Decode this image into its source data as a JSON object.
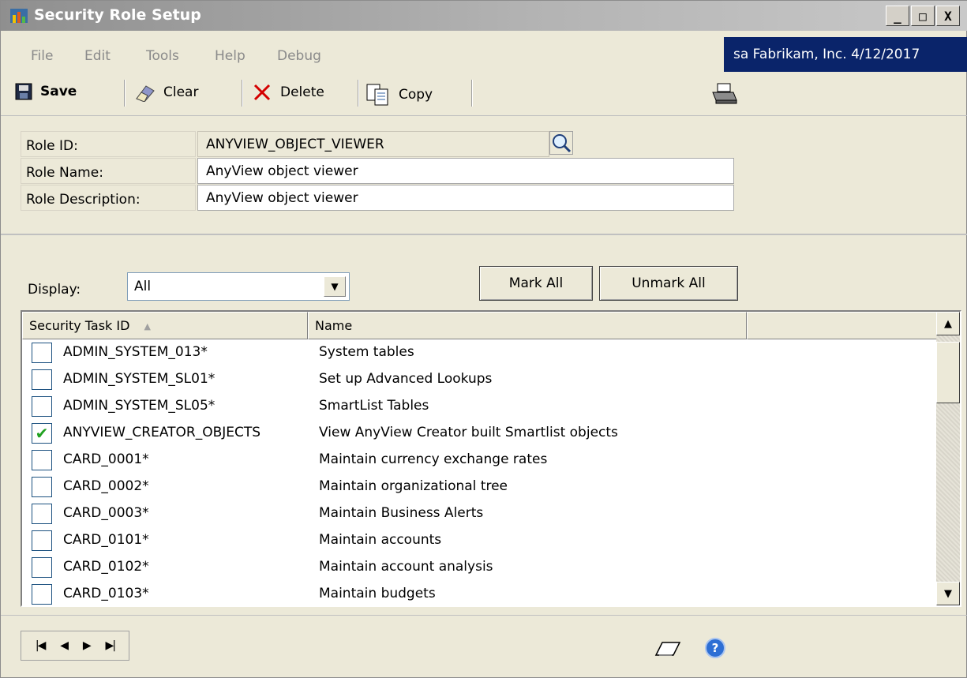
{
  "window": {
    "title": "Security Role Setup",
    "buttons": {
      "minimize": "_",
      "maximize": "□",
      "close": "X"
    }
  },
  "menu": [
    {
      "label": "File"
    },
    {
      "label": "Edit"
    },
    {
      "label": "Tools"
    },
    {
      "label": "Help"
    },
    {
      "label": "Debug"
    }
  ],
  "user_info": "sa  Fabrikam, Inc.  4/12/2017",
  "toolbar": {
    "save_label": "Save",
    "clear_label": "Clear",
    "delete_label": "Delete",
    "copy_label": "Copy"
  },
  "form": {
    "role_id_label": "Role ID:",
    "role_id_value": "ANYVIEW_OBJECT_VIEWER",
    "role_name_label": "Role Name:",
    "role_name_value": "AnyView object viewer",
    "role_description_label": "Role Description:",
    "role_description_value": "AnyView object viewer"
  },
  "display": {
    "label": "Display:",
    "value": "All"
  },
  "buttons": {
    "mark_all": "Mark All",
    "unmark_all": "Unmark All"
  },
  "grid": {
    "columns": [
      "Security Task ID",
      "Name",
      ""
    ],
    "rows": [
      {
        "id": "ADMIN_SYSTEM_013*",
        "name": "System tables",
        "checked": false
      },
      {
        "id": "ADMIN_SYSTEM_SL01*",
        "name": "Set up Advanced Lookups",
        "checked": false
      },
      {
        "id": "ADMIN_SYSTEM_SL05*",
        "name": "SmartList Tables",
        "checked": false
      },
      {
        "id": "ANYVIEW_CREATOR_OBJECTS",
        "name": "View AnyView Creator built Smartlist objects",
        "checked": true
      },
      {
        "id": "CARD_0001*",
        "name": "Maintain currency exchange rates",
        "checked": false
      },
      {
        "id": "CARD_0002*",
        "name": "Maintain organizational tree",
        "checked": false
      },
      {
        "id": "CARD_0003*",
        "name": "Maintain Business Alerts",
        "checked": false
      },
      {
        "id": "CARD_0101*",
        "name": "Maintain accounts",
        "checked": false
      },
      {
        "id": "CARD_0102*",
        "name": "Maintain account analysis",
        "checked": false
      },
      {
        "id": "CARD_0103*",
        "name": "Maintain budgets",
        "checked": false
      }
    ]
  }
}
